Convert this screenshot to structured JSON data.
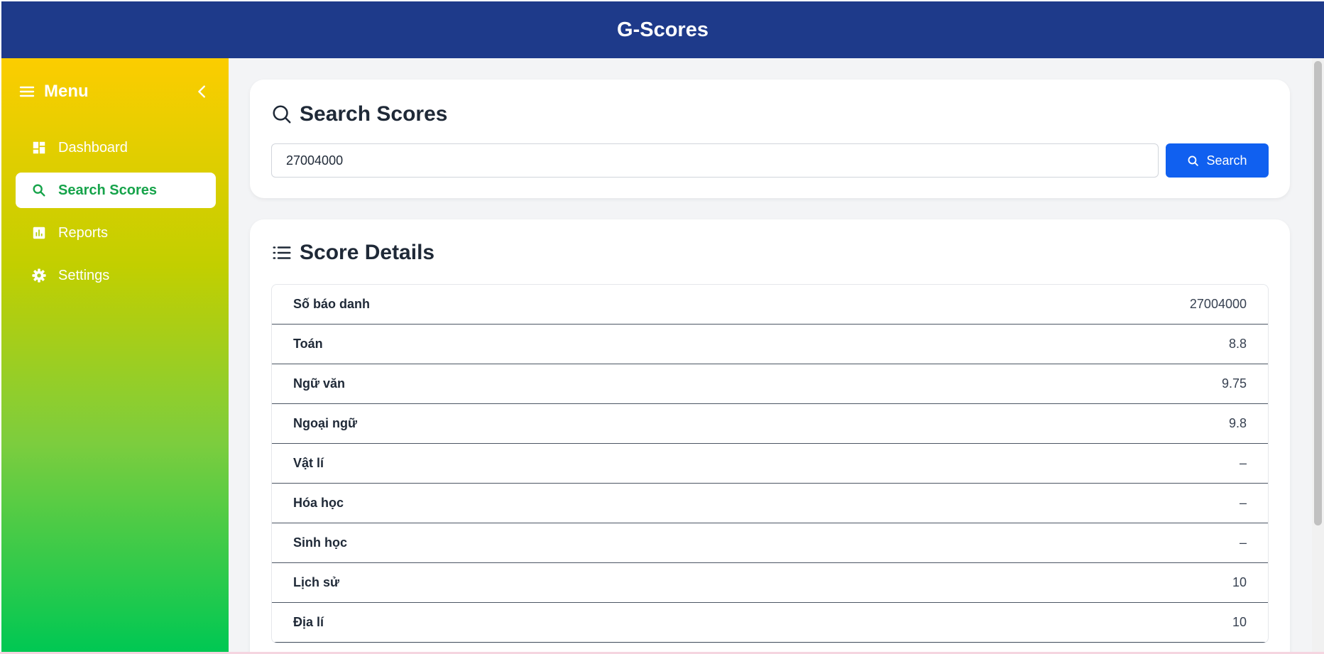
{
  "app": {
    "title": "G-Scores"
  },
  "sidebar": {
    "menu_title": "Menu",
    "items": [
      {
        "label": "Dashboard",
        "icon": "dashboard-icon",
        "active": false
      },
      {
        "label": "Search Scores",
        "icon": "search-icon",
        "active": true
      },
      {
        "label": "Reports",
        "icon": "bar-chart-icon",
        "active": false
      },
      {
        "label": "Settings",
        "icon": "gear-icon",
        "active": false
      }
    ]
  },
  "search": {
    "title": "Search Scores",
    "value": "27004000",
    "button_label": "Search"
  },
  "details": {
    "title": "Score Details",
    "rows": [
      {
        "label": "Số báo danh",
        "value": "27004000"
      },
      {
        "label": "Toán",
        "value": "8.8"
      },
      {
        "label": "Ngữ văn",
        "value": "9.75"
      },
      {
        "label": "Ngoại ngữ",
        "value": "9.8"
      },
      {
        "label": "Vật lí",
        "value": "–"
      },
      {
        "label": "Hóa học",
        "value": "–"
      },
      {
        "label": "Sinh học",
        "value": "–"
      },
      {
        "label": "Lịch sử",
        "value": "10"
      },
      {
        "label": "Địa lí",
        "value": "10"
      }
    ]
  },
  "colors": {
    "header": "#1e3a8a",
    "primary_button": "#1060f0",
    "active_nav_text": "#16a34a",
    "sidebar_gradient_top": "#fccd00",
    "sidebar_gradient_bottom": "#00c853"
  }
}
